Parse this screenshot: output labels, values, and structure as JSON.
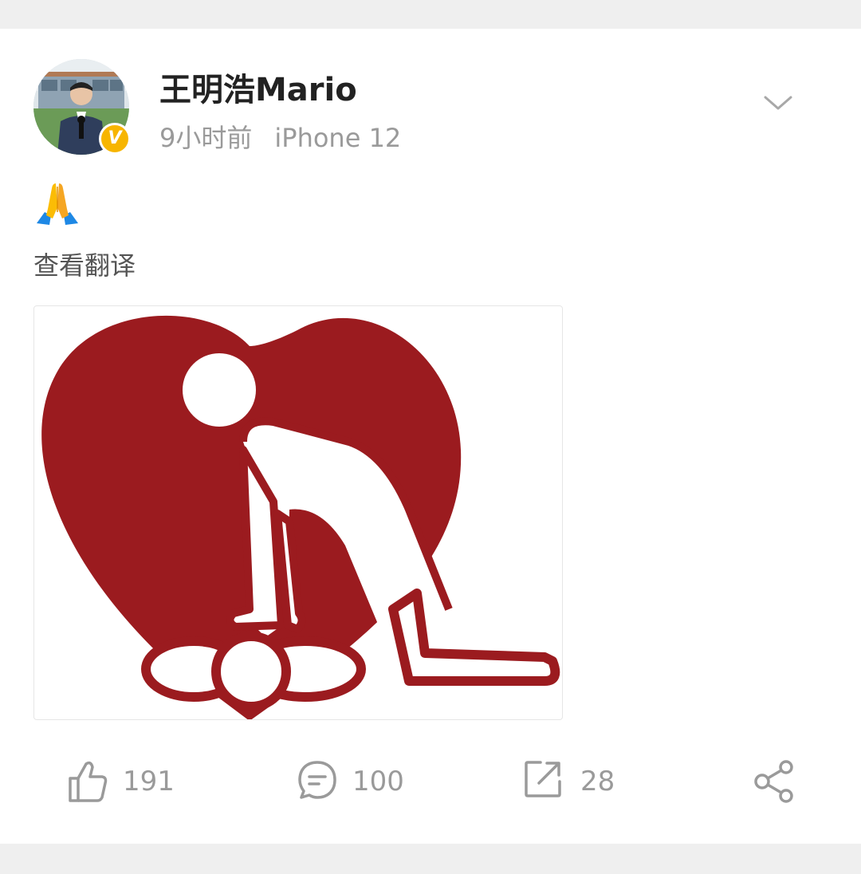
{
  "post": {
    "author": {
      "name": "王明浩Mario",
      "verified_badge": "V"
    },
    "meta": {
      "time": "9小时前",
      "device": "iPhone 12"
    },
    "content": {
      "emoji": "folded-hands-icon",
      "translate_link": "查看翻译"
    },
    "image": {
      "description_icon": "cpr-heart-logo"
    },
    "actions": {
      "like_count": "191",
      "comment_count": "100",
      "repost_count": "28"
    }
  },
  "colors": {
    "logo_red": "#9b1b1f",
    "badge": "#f7b500",
    "muted_text": "#9a9a9a"
  }
}
